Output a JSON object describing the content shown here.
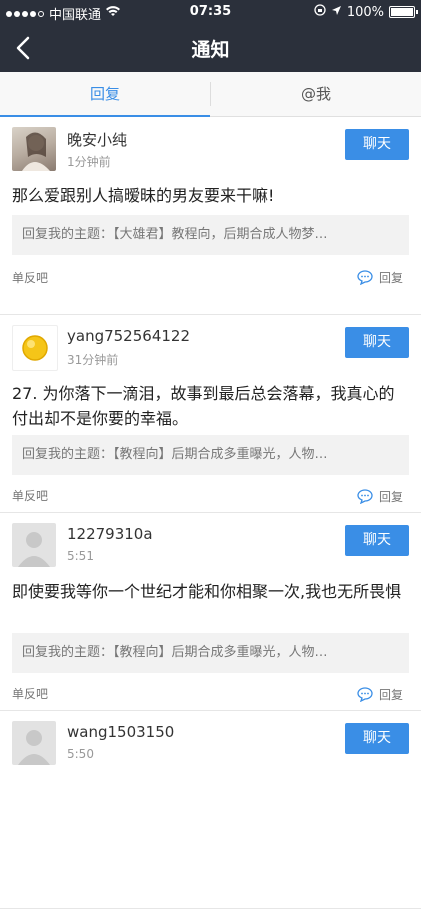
{
  "status_bar": {
    "carrier": "中国联通",
    "time": "07:35",
    "battery": "100%"
  },
  "nav": {
    "title": "通知"
  },
  "tabs": [
    {
      "label": "回复"
    },
    {
      "label": "@我"
    }
  ],
  "actions": {
    "chat_label": "聊天",
    "reply_label": "回复"
  },
  "feed": [
    {
      "username": "晚安小纯",
      "time": "1分钟前",
      "content": "那么爱跟别人搞暧昧的男友要来干嘛!",
      "quote": "回复我的主题：【大雄君】教程向，后期合成人物梦…",
      "board": "单反吧"
    },
    {
      "username": "yang752564122",
      "time": "31分钟前",
      "content": "27. 为你落下一滴泪，故事到最后总会落幕，我真心的付出却不是你要的幸福。",
      "quote": "回复我的主题：【教程向】后期合成多重曝光，人物…",
      "board": "单反吧"
    },
    {
      "username": "12279310a",
      "time": "5:51",
      "content": "即使要我等你一个世纪才能和你相聚一次,我也无所畏惧",
      "quote": "回复我的主题：【教程向】后期合成多重曝光，人物…",
      "board": "单反吧"
    },
    {
      "username": "wang1503150",
      "time": "5:50",
      "content": "",
      "quote": "",
      "board": ""
    }
  ]
}
